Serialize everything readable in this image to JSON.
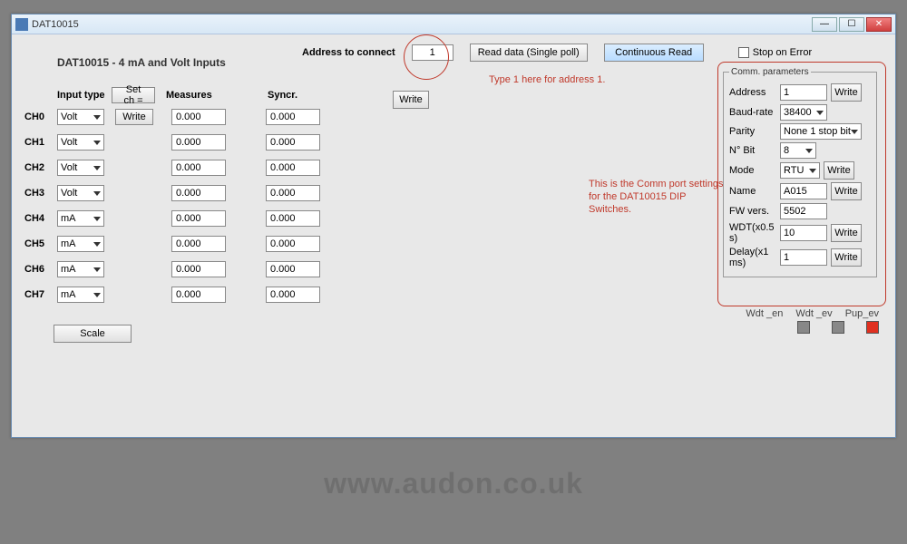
{
  "window": {
    "title": "DAT10015"
  },
  "header": {
    "subtitle": "DAT10015 - 4 mA and Volt Inputs",
    "address_label": "Address to connect",
    "address_value": "1",
    "read_button": "Read data (Single poll)",
    "continuous_button": "Continuous Read",
    "stop_on_error": "Stop on Error",
    "write_button": "Write"
  },
  "columns": {
    "input_type": "Input type",
    "set_ch": "Set ch =",
    "measures": "Measures",
    "syncr": "Syncr."
  },
  "channels": [
    {
      "name": "CH0",
      "type": "Volt",
      "write": "Write",
      "measure": "0.000",
      "syncr": "0.000"
    },
    {
      "name": "CH1",
      "type": "Volt",
      "write": "",
      "measure": "0.000",
      "syncr": "0.000"
    },
    {
      "name": "CH2",
      "type": "Volt",
      "write": "",
      "measure": "0.000",
      "syncr": "0.000"
    },
    {
      "name": "CH3",
      "type": "Volt",
      "write": "",
      "measure": "0.000",
      "syncr": "0.000"
    },
    {
      "name": "CH4",
      "type": "mA",
      "write": "",
      "measure": "0.000",
      "syncr": "0.000"
    },
    {
      "name": "CH5",
      "type": "mA",
      "write": "",
      "measure": "0.000",
      "syncr": "0.000"
    },
    {
      "name": "CH6",
      "type": "mA",
      "write": "",
      "measure": "0.000",
      "syncr": "0.000"
    },
    {
      "name": "CH7",
      "type": "mA",
      "write": "",
      "measure": "0.000",
      "syncr": "0.000"
    }
  ],
  "scale_button": "Scale",
  "annotations": {
    "addr_hint": "Type 1 here for address 1.",
    "comm_hint": "This is the Comm port settings for the DAT10015 DIP Switches."
  },
  "comm": {
    "legend": "Comm. parameters",
    "address_lbl": "Address",
    "address_val": "1",
    "baud_lbl": "Baud-rate",
    "baud_val": "38400",
    "parity_lbl": "Parity",
    "parity_val": "None 1 stop bit",
    "nbit_lbl": "N° Bit",
    "nbit_val": "8",
    "mode_lbl": "Mode",
    "mode_val": "RTU",
    "name_lbl": "Name",
    "name_val": "A015",
    "fw_lbl": "FW vers.",
    "fw_val": "5502",
    "wdt_lbl": "WDT(x0.5 s)",
    "wdt_val": "10",
    "delay_lbl": "Delay(x1 ms)",
    "delay_val": "1",
    "write": "Write"
  },
  "status": {
    "wdt_en": "Wdt _en",
    "wdt_ev": "Wdt _ev",
    "pup_ev": "Pup_ev"
  },
  "watermark": "www.audon.co.uk"
}
